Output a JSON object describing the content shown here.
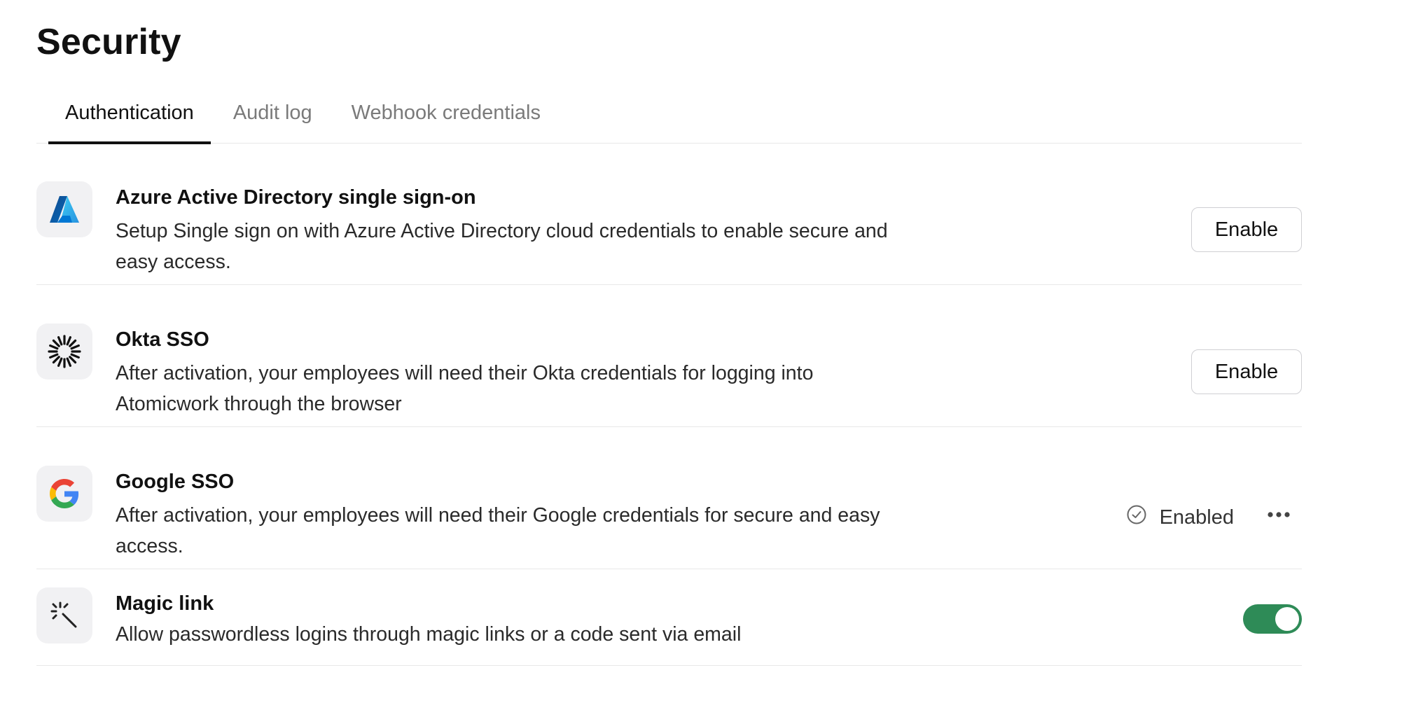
{
  "page": {
    "title": "Security"
  },
  "tabs": [
    {
      "label": "Authentication",
      "active": true
    },
    {
      "label": "Audit log",
      "active": false
    },
    {
      "label": "Webhook credentials",
      "active": false
    }
  ],
  "providers": [
    {
      "icon": "azure-logo-icon",
      "title": "Azure Active Directory single sign-on",
      "description": "Setup Single sign on with Azure Active Directory cloud credentials to enable secure and easy access.",
      "action_label": "Enable"
    },
    {
      "icon": "okta-logo-icon",
      "title": "Okta SSO",
      "description": "After activation, your employees will need their Okta credentials for logging into Atomicwork through the browser",
      "action_label": "Enable"
    },
    {
      "icon": "google-logo-icon",
      "title": "Google SSO",
      "description": "After activation, your employees will need their Google credentials for secure and easy access.",
      "status_label": "Enabled"
    },
    {
      "icon": "magic-wand-icon",
      "title": "Magic link",
      "description": "Allow passwordless logins through magic links or a code sent via email",
      "toggle_on": true
    }
  ],
  "colors": {
    "toggle_on": "#2e8b57",
    "icon_bg": "#f1f1f3",
    "divider": "#e8e8e8",
    "azure_blue": "#1a73c9",
    "google_blue": "#4285F4",
    "google_red": "#EA4335",
    "google_yellow": "#FBBC05",
    "google_green": "#34A853"
  }
}
